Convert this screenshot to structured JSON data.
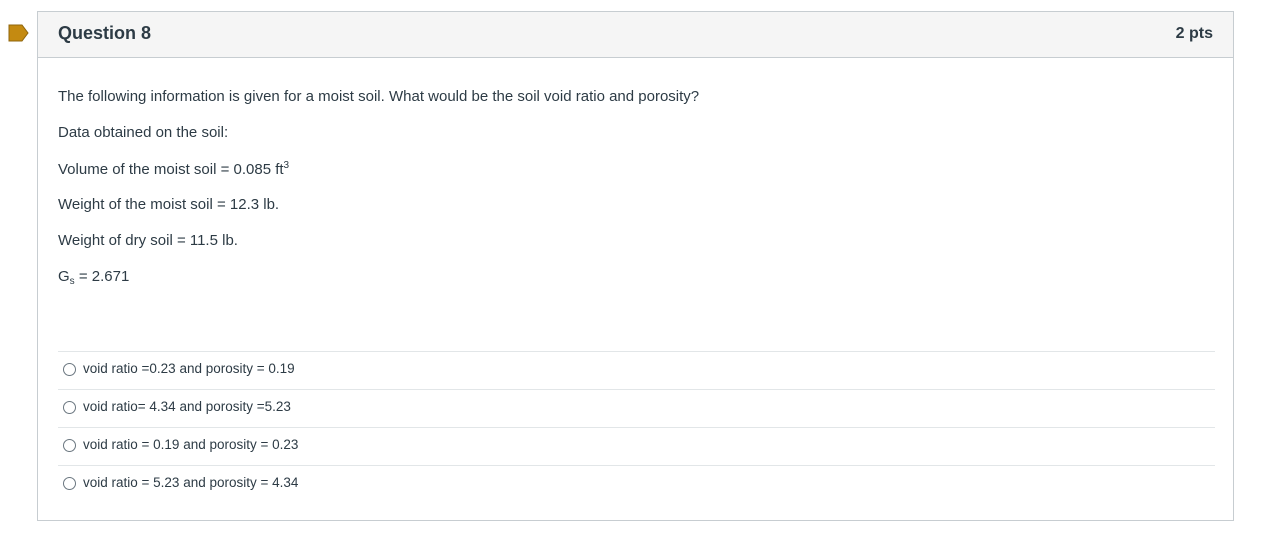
{
  "question": {
    "title": "Question 8",
    "points": "2 pts",
    "flag_color": "#c48a11",
    "prompt": "The following information is given for a moist soil.  What would be the soil void ratio and porosity?",
    "data_heading": "Data obtained on the soil:",
    "volume_label": "Volume of the moist soil = 0.085 ft",
    "volume_exponent": "3",
    "weight_moist": "Weight of the moist soil = 12.3 lb.",
    "weight_dry": "Weight of dry soil = 11.5 lb.",
    "gs_base": "G",
    "gs_sub": "s",
    "gs_value": " = 2.671"
  },
  "answers": [
    {
      "label": "void ratio =0.23 and porosity = 0.19"
    },
    {
      "label": "void ratio= 4.34 and porosity =5.23"
    },
    {
      "label": "void ratio = 0.19 and porosity = 0.23"
    },
    {
      "label": "void ratio = 5.23 and porosity = 4.34"
    }
  ]
}
